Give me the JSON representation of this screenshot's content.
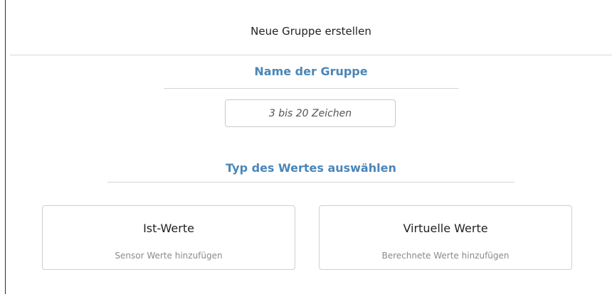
{
  "dialog": {
    "title": "Neue Gruppe erstellen"
  },
  "name_section": {
    "title": "Name der Gruppe",
    "input": {
      "value": "",
      "placeholder": "3 bis 20 Zeichen"
    }
  },
  "type_section": {
    "title": "Typ des Wertes auswählen",
    "options": [
      {
        "title": "Ist-Werte",
        "subtitle": "Sensor Werte hinzufügen"
      },
      {
        "title": "Virtuelle Werte",
        "subtitle": "Berechnete Werte hinzufügen"
      }
    ]
  },
  "colors": {
    "accent": "#4a86b8",
    "border": "#cfcfcf",
    "muted_text": "#8a8a8a"
  }
}
